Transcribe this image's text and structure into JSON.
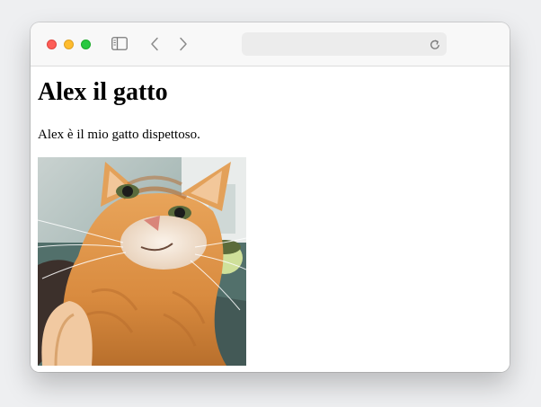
{
  "browser": {
    "address_value": "",
    "icons": {
      "close": "close-button",
      "minimize": "minimize-button",
      "zoom": "zoom-button",
      "sidebar": "sidebar-icon",
      "back": "chevron-left-icon",
      "forward": "chevron-right-icon",
      "reload": "reload-icon"
    },
    "colors": {
      "close": "#fd5e57",
      "minimize": "#febc2e",
      "zoom": "#28c840"
    }
  },
  "page": {
    "heading": "Alex il gatto",
    "paragraph": "Alex è il mio gatto dispettoso.",
    "image": {
      "subject": "orange tabby cat selfie"
    }
  }
}
